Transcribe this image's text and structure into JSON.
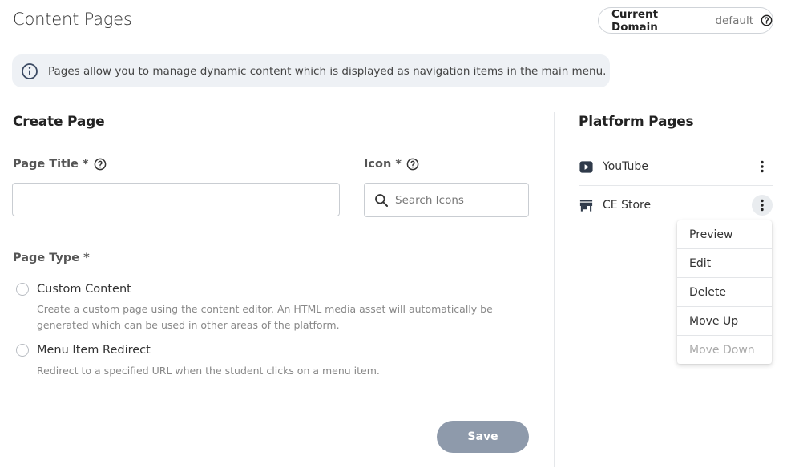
{
  "page": {
    "title": "Content Pages"
  },
  "domain": {
    "label": "Current Domain",
    "value": "default"
  },
  "info": {
    "message": "Pages allow you to manage dynamic content which is displayed as navigation items in the main menu."
  },
  "create": {
    "title": "Create Page",
    "page_title_label": "Page Title *",
    "page_title_value": "",
    "icon_label": "Icon *",
    "icon_placeholder": "Search Icons",
    "page_type_label": "Page Type *",
    "types": [
      {
        "label": "Custom Content",
        "description": "Create a custom page using the content editor. An HTML media asset will automatically be generated which can be used in other areas of the platform."
      },
      {
        "label": "Menu Item Redirect",
        "description": "Redirect to a specified URL when the student clicks on a menu item."
      }
    ],
    "save_label": "Save"
  },
  "platform": {
    "title": "Platform Pages",
    "items": [
      {
        "label": "YouTube",
        "icon": "youtube-icon"
      },
      {
        "label": "CE Store",
        "icon": "store-icon"
      }
    ]
  },
  "menu": {
    "items": [
      {
        "label": "Preview",
        "enabled": true
      },
      {
        "label": "Edit",
        "enabled": true
      },
      {
        "label": "Delete",
        "enabled": true
      },
      {
        "label": "Move Up",
        "enabled": true
      },
      {
        "label": "Move Down",
        "enabled": false
      }
    ]
  },
  "colors": {
    "save_button": "#8e9aab",
    "banner_bg": "#eef1f5",
    "info_icon": "#3b4a63"
  }
}
